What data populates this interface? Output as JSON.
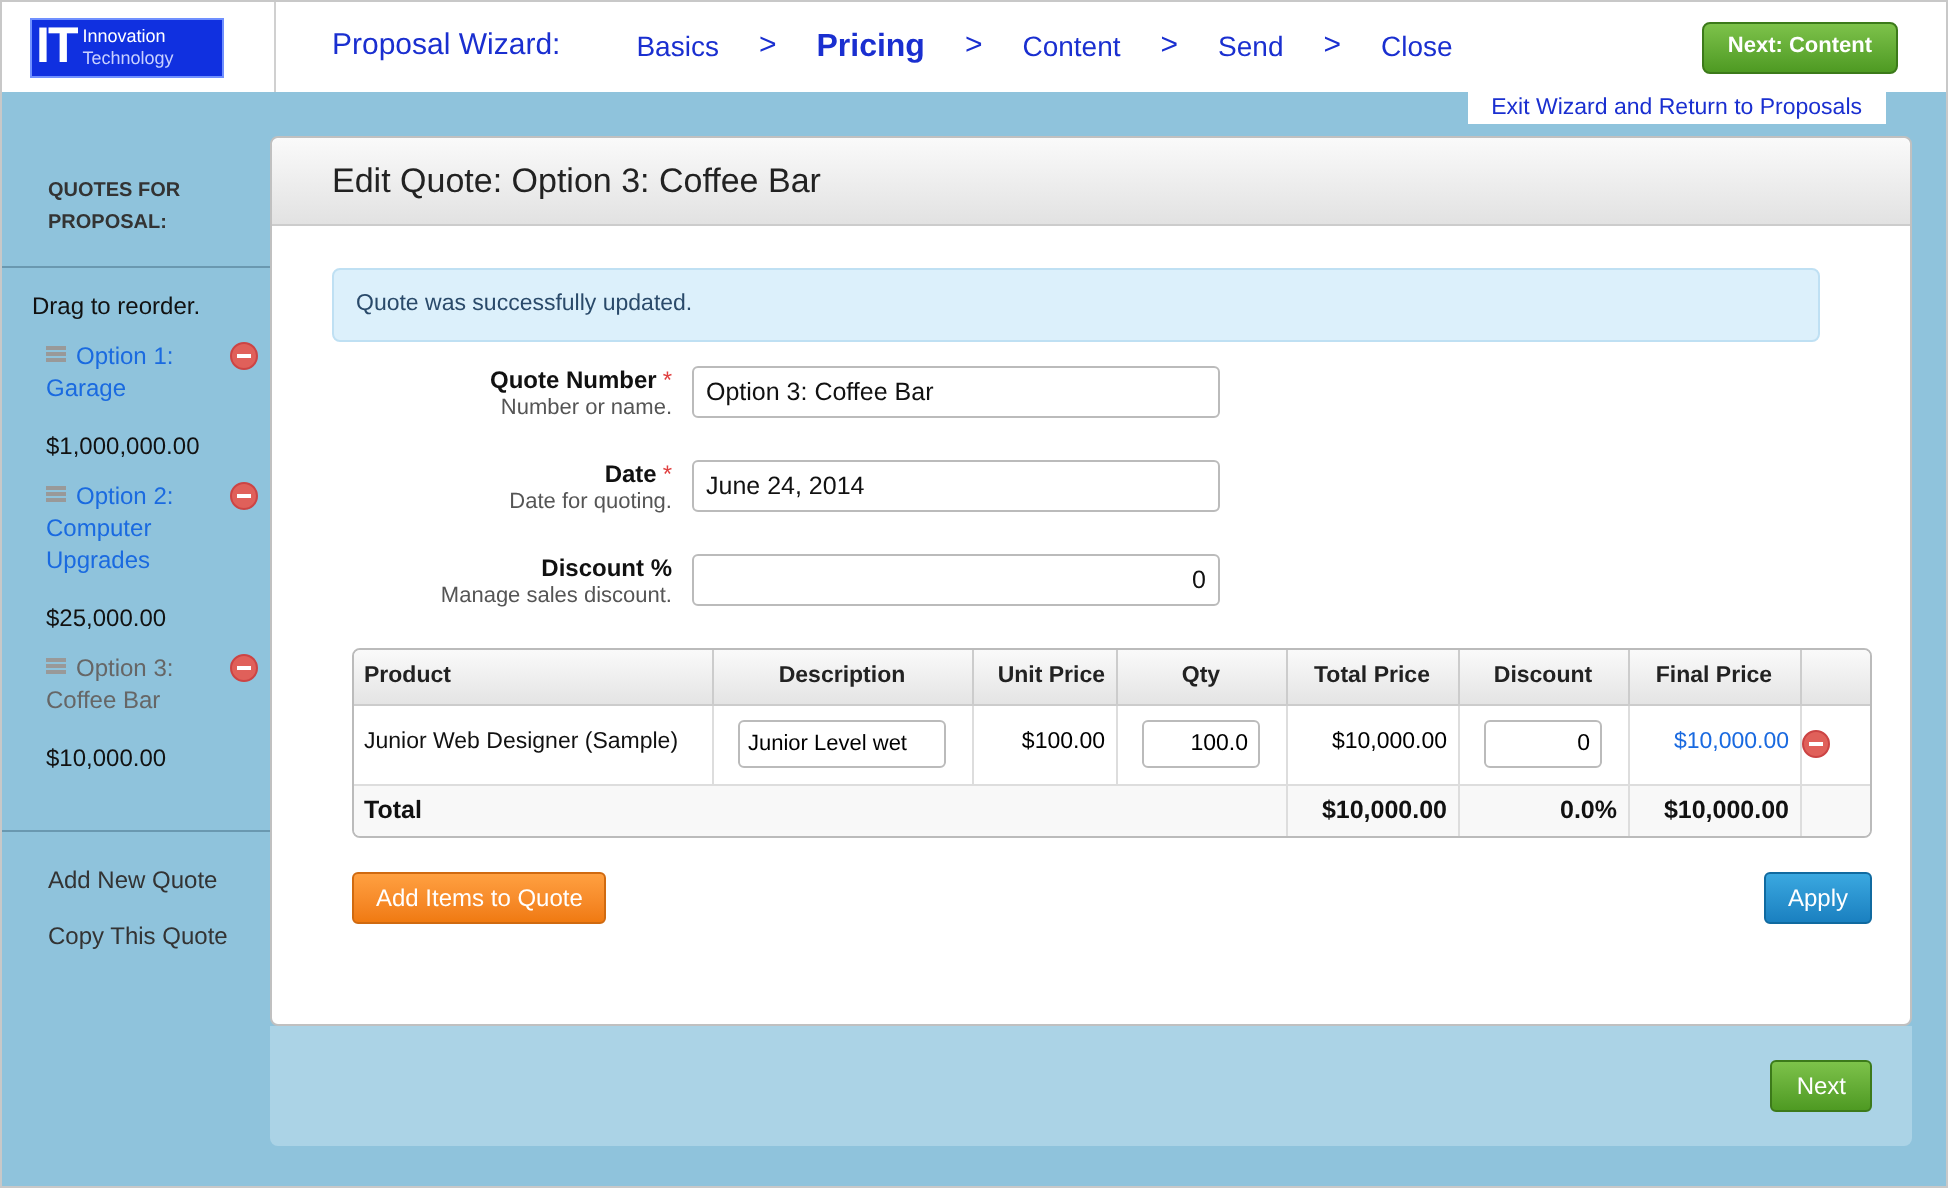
{
  "logo": {
    "mark": "IT",
    "line_1": "Innovation",
    "line_2": "Technology"
  },
  "wizard": {
    "title": "Proposal Wizard:",
    "separator": ">",
    "steps": [
      {
        "label": "Basics",
        "selected": false
      },
      {
        "label": "Pricing",
        "selected": true
      },
      {
        "label": "Content",
        "selected": false
      },
      {
        "label": "Send",
        "selected": false
      },
      {
        "label": "Close",
        "selected": false
      }
    ]
  },
  "next_top": "Next: Content",
  "exit_link": "Exit Wizard and Return to Proposals",
  "sidebar": {
    "heading": "QUOTES FOR PROPOSAL:",
    "hint": "Drag to reorder.",
    "quotes": [
      {
        "name": "Option 1: Garage",
        "amount": "$1,000,000.00",
        "selected": false
      },
      {
        "name": "Option 2: Computer Upgrades",
        "amount": "$25,000.00",
        "selected": false
      },
      {
        "name": "Option 3: Coffee Bar",
        "amount": "$10,000.00",
        "selected": true
      }
    ],
    "actions": [
      "Add New Quote",
      "Copy This Quote"
    ]
  },
  "panel_title": "Edit Quote: Option 3: Coffee Bar",
  "notice": "Quote was successfully updated.",
  "fields": [
    {
      "label": "Quote Number",
      "required_mark": "*",
      "help": "Number or name.",
      "value": "Option 3: Coffee Bar",
      "kind": "text"
    },
    {
      "label": "Date",
      "required_mark": "*",
      "help": "Date for quoting.",
      "value": "June 24, 2014",
      "kind": "text"
    },
    {
      "label": "Discount %",
      "help": "Manage sales discount.",
      "value": "0",
      "kind": "number"
    }
  ],
  "table": {
    "columns": [
      "Product",
      "Description",
      "Unit Price",
      "Qty",
      "Total Price",
      "Discount",
      "Final Price"
    ],
    "rows": [
      {
        "product": "Junior Web Designer (Sample)",
        "description": "Junior Level wet",
        "unit_price": "$100.00",
        "qty": "100.0",
        "total_price": "$10,000.00",
        "discount": "0",
        "final_price": "$10,000.00"
      }
    ],
    "total": {
      "label": "Total",
      "total_price": "$10,000.00",
      "discount": "0.0%",
      "final_price": "$10,000.00"
    }
  },
  "add_items": "Add Items to Quote",
  "apply": "Apply",
  "next_bottom": "Next"
}
